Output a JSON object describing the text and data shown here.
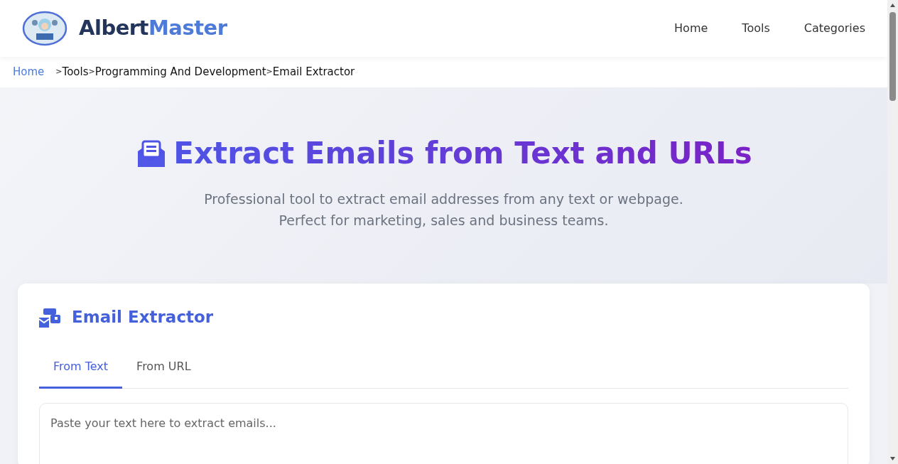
{
  "header": {
    "logo_text_dark": "Albert",
    "logo_text_accent": "Master",
    "nav": [
      {
        "label": "Home"
      },
      {
        "label": "Tools"
      },
      {
        "label": "Categories"
      }
    ]
  },
  "breadcrumb": [
    {
      "kind": "link",
      "label": "Home"
    },
    {
      "kind": "separator",
      "label": ">"
    },
    {
      "kind": "text",
      "label": "Tools"
    },
    {
      "kind": "separator",
      "label": ">"
    },
    {
      "kind": "text",
      "label": "Programming And Development"
    },
    {
      "kind": "separator",
      "label": ">"
    },
    {
      "kind": "text",
      "label": "Email Extractor"
    }
  ],
  "hero": {
    "title": "Extract Emails from Text and URLs",
    "subtitle_lines": [
      "Professional tool to extract email addresses from any text or webpage.",
      "Perfect for marketing, sales and business teams."
    ]
  },
  "tool": {
    "title": "Email Extractor",
    "tabs": [
      {
        "label": "From Text",
        "selected": true
      },
      {
        "label": "From URL",
        "selected": false
      }
    ],
    "textarea": {
      "placeholder": "Paste your text here to extract emails..."
    }
  }
}
